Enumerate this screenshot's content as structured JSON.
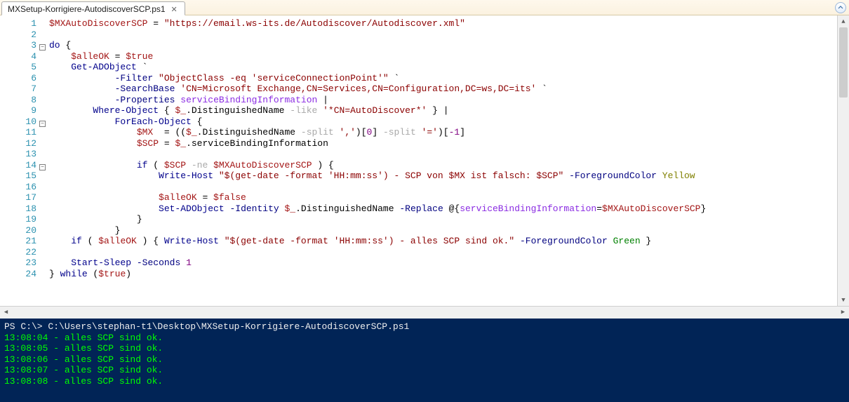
{
  "tab": {
    "title": "MXSetup-Korrigiere-AutodiscoverSCP.ps1"
  },
  "gutter": {
    "lines": [
      "1",
      "2",
      "3",
      "4",
      "5",
      "6",
      "7",
      "8",
      "9",
      "10",
      "11",
      "12",
      "13",
      "14",
      "15",
      "16",
      "17",
      "18",
      "19",
      "20",
      "21",
      "22",
      "23",
      "24"
    ]
  },
  "fold": {
    "marks": {
      "3": "minus",
      "10": "minus",
      "14": "minus"
    }
  },
  "code": {
    "l1": {
      "var1": "$MXAutoDiscoverSCP",
      "eq": " = ",
      "str": "\"https://email.ws-its.de/Autodiscover/Autodiscover.xml\""
    },
    "l2": {
      "text": ""
    },
    "l3": {
      "kw": "do",
      "brace": " {"
    },
    "l4": {
      "indent": "    ",
      "var": "$alleOK",
      "eq": " = ",
      "val": "$true"
    },
    "l5": {
      "indent": "    ",
      "cmd": "Get-ADObject",
      "tick": " `"
    },
    "l6": {
      "indent": "            ",
      "param": "-Filter",
      "sp": " ",
      "str": "\"ObjectClass -eq 'serviceConnectionPoint'\"",
      "tick": " `"
    },
    "l7": {
      "indent": "            ",
      "param": "-SearchBase",
      "sp": " ",
      "str": "'CN=Microsoft Exchange,CN=Services,CN=Configuration,DC=ws,DC=its'",
      "tick": " `"
    },
    "l8": {
      "indent": "            ",
      "param": "-Properties",
      "sp": " ",
      "prop": "serviceBindingInformation",
      "pipe": " |"
    },
    "l9": {
      "indent": "        ",
      "cmd": "Where-Object",
      "sp": " { ",
      "var": "$_",
      "mem": ".DistinguishedName",
      "op": " -like ",
      "str": "'*CN=AutoDiscover*'",
      "end": " } |"
    },
    "l10": {
      "indent": "            ",
      "cmd": "ForEach-Object",
      "brace": " {"
    },
    "l11": {
      "indent": "                ",
      "var": "$MX",
      "eqsp": "  = ((",
      "var2": "$_",
      "mem": ".DistinguishedName",
      "op": " -split ",
      "str": "','",
      "mid": ")[",
      "num": "0",
      "mid2": "] ",
      "op2": "-split ",
      "str2": "'='",
      "end": ")[",
      "num2": "-1",
      "end2": "]"
    },
    "l12": {
      "indent": "                ",
      "var": "$SCP",
      "eq": " = ",
      "var2": "$_",
      "mem": ".serviceBindingInformation"
    },
    "l13": {
      "text": ""
    },
    "l14": {
      "indent": "                ",
      "kw": "if",
      "open": " ( ",
      "var": "$SCP",
      "op": " -ne ",
      "var2": "$MXAutoDiscoverSCP",
      "close": " ) {"
    },
    "l15": {
      "indent": "                    ",
      "cmd": "Write-Host",
      "sp": " ",
      "str": "\"$(get-date -format 'HH:mm:ss') - SCP von $MX ist falsch: $SCP\"",
      "sp2": " ",
      "param": "-ForegroundColor",
      "sp3": " ",
      "color": "Yellow"
    },
    "l16": {
      "text": ""
    },
    "l17": {
      "indent": "                    ",
      "var": "$alleOK",
      "eq": " = ",
      "val": "$false"
    },
    "l18": {
      "indent": "                    ",
      "cmd": "Set-ADObject",
      "sp": " ",
      "param": "-Identity",
      "sp2": " ",
      "var": "$_",
      "mem": ".DistinguishedName",
      "sp3": " ",
      "param2": "-Replace",
      "sp4": " @{",
      "prop": "serviceBindingInformation",
      "eq": "=",
      "var2": "$MXAutoDiscoverSCP",
      "close": "}"
    },
    "l19": {
      "indent": "                ",
      "close": "}"
    },
    "l20": {
      "indent": "            ",
      "close": "}"
    },
    "l21": {
      "indent": "    ",
      "kw": "if",
      "open": " ( ",
      "var": "$alleOK",
      "close": " ) { ",
      "cmd": "Write-Host",
      "sp": " ",
      "str": "\"$(get-date -format 'HH:mm:ss') - alles SCP sind ok.\"",
      "sp2": " ",
      "param": "-ForegroundColor",
      "sp3": " ",
      "color": "Green",
      "end": " }"
    },
    "l22": {
      "text": ""
    },
    "l23": {
      "indent": "    ",
      "cmd": "Start-Sleep",
      "sp": " ",
      "param": "-Seconds",
      "sp2": " ",
      "num": "1"
    },
    "l24": {
      "close": "} ",
      "kw": "while",
      "open": " (",
      "var": "$true",
      "end": ")"
    }
  },
  "console": {
    "prompt": "PS C:\\> C:\\Users\\stephan-t1\\Desktop\\MXSetup-Korrigiere-AutodiscoverSCP.ps1",
    "lines": [
      "13:08:04 - alles SCP sind ok.",
      "13:08:05 - alles SCP sind ok.",
      "13:08:06 - alles SCP sind ok.",
      "13:08:07 - alles SCP sind ok.",
      "13:08:08 - alles SCP sind ok."
    ]
  }
}
